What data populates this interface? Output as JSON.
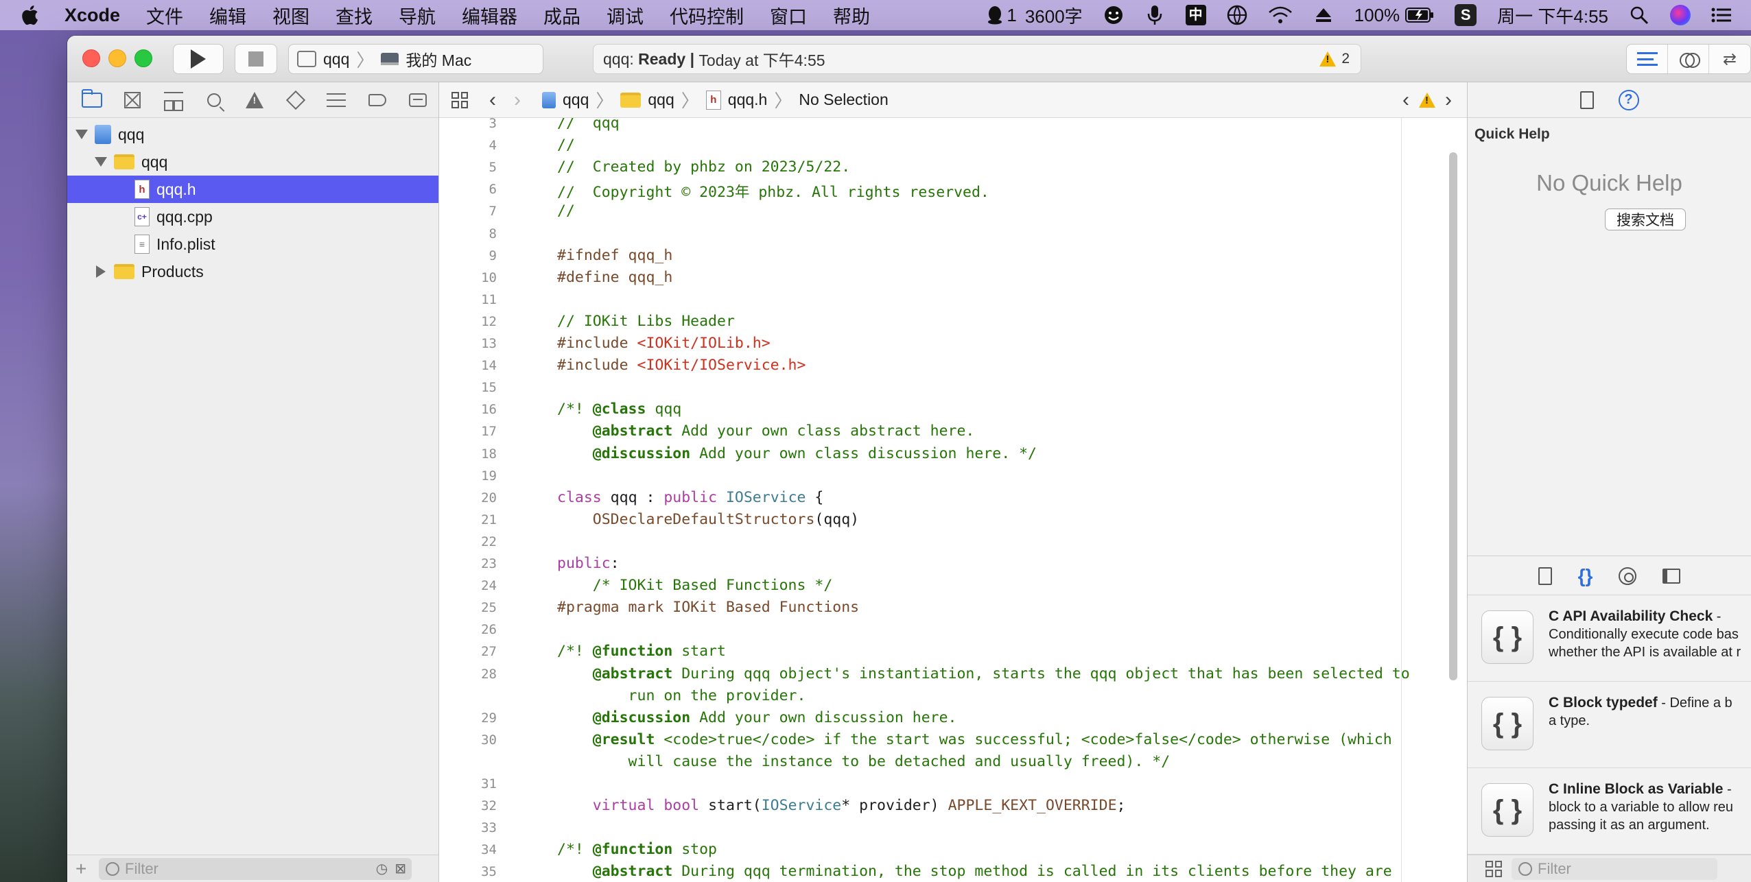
{
  "menubar": {
    "app_name": "Xcode",
    "menus": [
      "文件",
      "编辑",
      "视图",
      "查找",
      "导航",
      "编辑器",
      "成品",
      "调试",
      "代码控制",
      "窗口",
      "帮助"
    ],
    "status": {
      "qq_count": "1",
      "word_count": "3600字",
      "input_method": "中",
      "battery": "100%",
      "clock": "周一 下午4:55",
      "sogou": "S"
    }
  },
  "toolbar": {
    "scheme": "qqq",
    "destination": "我的 Mac",
    "activity": {
      "project": "qqq:",
      "status": "Ready",
      "separator": "|",
      "time": "Today at 下午4:55",
      "warning_count": "2"
    }
  },
  "navigator": {
    "tree": [
      {
        "label": "qqq",
        "kind": "project",
        "level": 0,
        "expanded": true
      },
      {
        "label": "qqq",
        "kind": "folder",
        "level": 1,
        "expanded": true
      },
      {
        "label": "qqq.h",
        "kind": "header",
        "level": 2,
        "selected": true
      },
      {
        "label": "qqq.cpp",
        "kind": "cpp",
        "level": 2
      },
      {
        "label": "Info.plist",
        "kind": "plist",
        "level": 2
      },
      {
        "label": "Products",
        "kind": "folder",
        "level": 1,
        "expanded": false
      }
    ],
    "filter_placeholder": "Filter"
  },
  "jumpbar": {
    "crumbs": [
      "qqq",
      "qqq",
      "qqq.h",
      "No Selection"
    ]
  },
  "editor": {
    "lines": [
      {
        "n": "3",
        "html": "<span class=\"c-com\">//  qqq</span>"
      },
      {
        "n": "4",
        "html": "<span class=\"c-com\">//</span>"
      },
      {
        "n": "5",
        "html": "<span class=\"c-com\">//  Created by phbz on 2023/5/22.</span>"
      },
      {
        "n": "6",
        "html": "<span class=\"c-com\">//  Copyright © 2023年 phbz. All rights reserved.</span>"
      },
      {
        "n": "7",
        "html": "<span class=\"c-com\">//</span>"
      },
      {
        "n": "8",
        "html": ""
      },
      {
        "n": "9",
        "html": "<span class=\"c-pre\">#ifndef qqq_h</span>"
      },
      {
        "n": "10",
        "html": "<span class=\"c-pre\">#define qqq_h</span>"
      },
      {
        "n": "11",
        "html": ""
      },
      {
        "n": "12",
        "html": "<span class=\"c-com\">// IOKit Libs Header</span>"
      },
      {
        "n": "13",
        "html": "<span class=\"c-pre\">#include </span><span class=\"c-str\">&lt;IOKit/IOLib.h&gt;</span>"
      },
      {
        "n": "14",
        "html": "<span class=\"c-pre\">#include </span><span class=\"c-str\">&lt;IOKit/IOService.h&gt;</span>"
      },
      {
        "n": "15",
        "html": ""
      },
      {
        "n": "16",
        "html": "<span class=\"c-doc\">/*! </span><span class=\"c-doctag\">@class</span><span class=\"c-doc\"> qqq</span>"
      },
      {
        "n": "17",
        "html": "<span class=\"c-doc\">    </span><span class=\"c-doctag\">@abstract</span><span class=\"c-doc\"> Add your own class abstract here.</span>"
      },
      {
        "n": "18",
        "html": "<span class=\"c-doc\">    </span><span class=\"c-doctag\">@discussion</span><span class=\"c-doc\"> Add your own class discussion here. */</span>"
      },
      {
        "n": "19",
        "html": ""
      },
      {
        "n": "20",
        "html": "<span class=\"c-kw\">class</span> qqq : <span class=\"c-kw\">public</span> <span class=\"c-type\">IOService</span> {"
      },
      {
        "n": "21",
        "html": "    <span class=\"c-fn\">OSDeclareDefaultStructors</span>(qqq)"
      },
      {
        "n": "22",
        "html": ""
      },
      {
        "n": "23",
        "html": "<span class=\"c-kw\">public</span>:"
      },
      {
        "n": "24",
        "html": "    <span class=\"c-com\">/* IOKit Based Functions */</span>"
      },
      {
        "n": "25",
        "html": "<span class=\"c-pre\">#pragma mark IOKit Based Functions</span>"
      },
      {
        "n": "26",
        "html": ""
      },
      {
        "n": "27",
        "html": "<span class=\"c-doc\">/*! </span><span class=\"c-doctag\">@function</span><span class=\"c-doc\"> start</span>"
      },
      {
        "n": "28",
        "html": "<span class=\"c-doc\">    </span><span class=\"c-doctag\">@abstract</span><span class=\"c-doc\"> During qqq object's instantiation, starts the qqq object that has been selected to</span>"
      },
      {
        "n": "",
        "html": "<span class=\"c-doc\">        run on the provider.</span>"
      },
      {
        "n": "29",
        "html": "<span class=\"c-doc\">    </span><span class=\"c-doctag\">@discussion</span><span class=\"c-doc\"> Add your own discussion here.</span>"
      },
      {
        "n": "30",
        "html": "<span class=\"c-doc\">    </span><span class=\"c-doctag\">@result</span><span class=\"c-doc\"> &lt;code&gt;true&lt;/code&gt; if the start was successful; &lt;code&gt;false&lt;/code&gt; otherwise (which</span>"
      },
      {
        "n": "",
        "html": "<span class=\"c-doc\">        will cause the instance to be detached and usually freed). */</span>"
      },
      {
        "n": "31",
        "html": ""
      },
      {
        "n": "32",
        "html": "    <span class=\"c-kw\">virtual</span> <span class=\"c-kw\">bool</span> start(<span class=\"c-type\">IOService</span>* provider) <span class=\"c-fn\">APPLE_KEXT_OVERRIDE</span>;"
      },
      {
        "n": "33",
        "html": ""
      },
      {
        "n": "34",
        "html": "<span class=\"c-doc\">/*! </span><span class=\"c-doctag\">@function</span><span class=\"c-doc\"> stop</span>"
      },
      {
        "n": "35",
        "html": "<span class=\"c-doc\">    </span><span class=\"c-doctag\">@abstract</span><span class=\"c-doc\"> During qqq termination, the stop method is called in its clients before they are</span>"
      }
    ]
  },
  "inspector": {
    "title": "Quick Help",
    "empty_message": "No Quick Help",
    "search_docs_label": "搜索文档",
    "snippets": [
      {
        "title": "C API Availability Check",
        "suffix": " -",
        "desc1": "Conditionally execute code bas",
        "desc2": "whether the API is available at r"
      },
      {
        "title": "C Block typedef",
        "suffix": " - Define a b",
        "desc1": "a type.",
        "desc2": ""
      },
      {
        "title": "C Inline Block as Variable",
        "suffix": " -",
        "desc1": "block to a variable to allow reu",
        "desc2": "passing it as an argument."
      }
    ],
    "filter_placeholder": "Filter"
  }
}
